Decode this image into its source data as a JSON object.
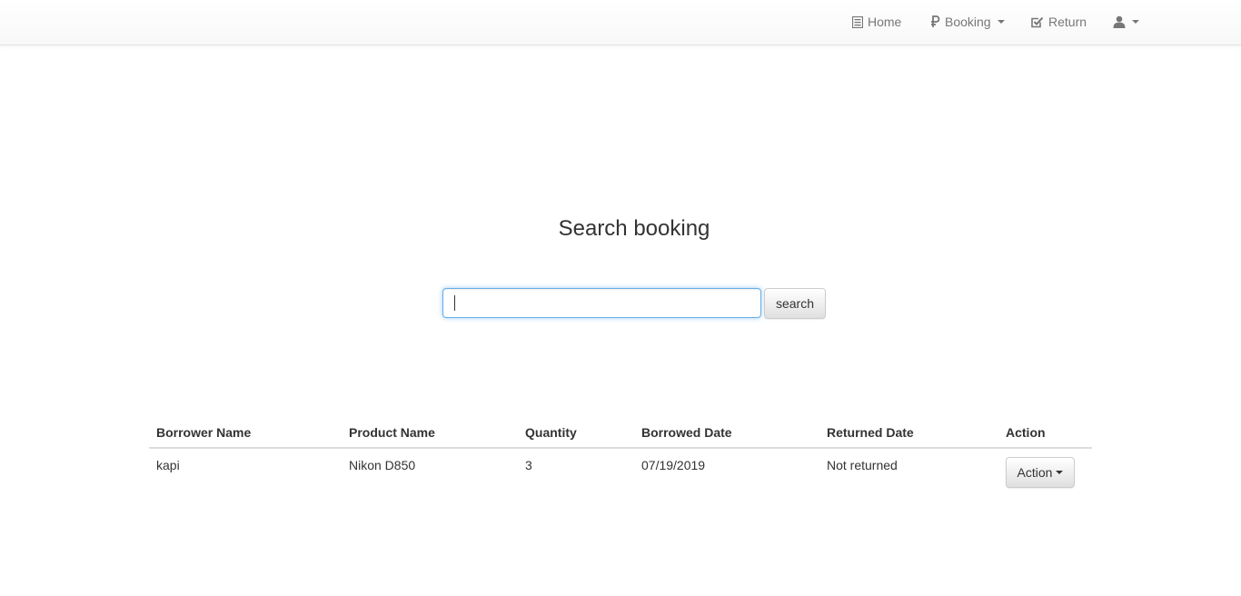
{
  "navbar": {
    "items": [
      {
        "label": "Home",
        "icon": "list-alt-icon"
      },
      {
        "label": "Booking",
        "icon": "ruble-icon",
        "dropdown": true
      },
      {
        "label": "Return",
        "icon": "check-square-icon"
      },
      {
        "label": "",
        "icon": "user-icon",
        "dropdown": true
      }
    ]
  },
  "page": {
    "title": "Search booking"
  },
  "search": {
    "value": "",
    "button_label": "search"
  },
  "table": {
    "columns": [
      "Borrower Name",
      "Product Name",
      "Quantity",
      "Borrowed Date",
      "Returned Date",
      "Action"
    ],
    "rows": [
      {
        "borrower": "kapi",
        "product": "Nikon D850",
        "quantity": "3",
        "borrowed_date": "07/19/2019",
        "returned_date": "Not returned",
        "action_label": "Action"
      }
    ]
  },
  "colors": {
    "nav_text": "#777777",
    "focus_border": "#66afe9",
    "text": "#333333"
  }
}
